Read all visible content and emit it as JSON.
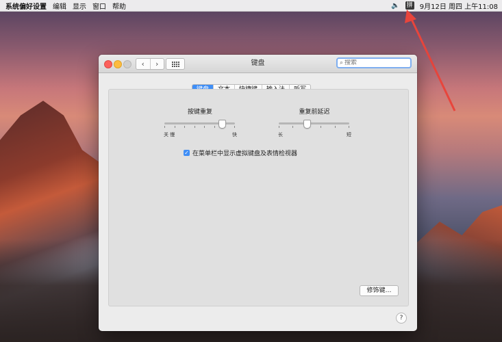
{
  "menubar": {
    "app_name": "系统偏好设置",
    "items": [
      "编辑",
      "显示",
      "窗口",
      "帮助"
    ],
    "volume_icon": "speaker-icon",
    "input_method": "拼",
    "datetime": "9月12日 周四 上午11:08"
  },
  "window": {
    "title": "键盘",
    "nav_back": "‹",
    "nav_forward": "›",
    "search_placeholder": "搜索"
  },
  "tabs": [
    {
      "label": "键盘",
      "active": true
    },
    {
      "label": "文本",
      "active": false
    },
    {
      "label": "快捷键",
      "active": false
    },
    {
      "label": "输入法",
      "active": false
    },
    {
      "label": "听写",
      "active": false
    }
  ],
  "key_repeat": {
    "title": "按键重复",
    "left_labels": "关 慢",
    "right_label": "快",
    "value_fraction": 0.82
  },
  "delay_until_repeat": {
    "title": "重复前延迟",
    "left_label": "长",
    "right_label": "短",
    "value_fraction": 0.4
  },
  "checkbox": {
    "label": "在菜单栏中显示虚拟键盘及表情检视器",
    "checked": true
  },
  "modifier_button": "修饰键…",
  "help_button": "?",
  "colors": {
    "accent": "#3f8ef6",
    "annotation_arrow": "#e8453c"
  }
}
